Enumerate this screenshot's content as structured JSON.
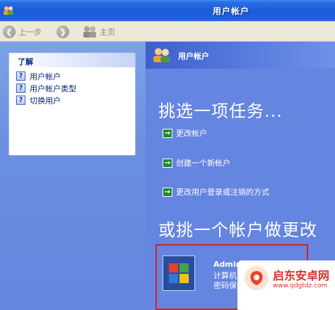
{
  "window": {
    "title": "用户帐户"
  },
  "toolbar": {
    "back_label": "上一步",
    "home_label": "主页"
  },
  "sidebar": {
    "panel_title": "了解",
    "items": [
      {
        "label": "用户帐户",
        "icon": "help-icon"
      },
      {
        "label": "用户帐户类型",
        "icon": "help-icon"
      },
      {
        "label": "切换用户",
        "icon": "help-icon"
      }
    ]
  },
  "main": {
    "header_title": "用户帐户",
    "pick_task": "挑选一项任务...",
    "tasks": [
      {
        "label": "更改帐户",
        "icon": "green-arrow-icon"
      },
      {
        "label": "创建一个新帐户",
        "icon": "green-arrow-icon"
      },
      {
        "label": "更改用户登录或注销的方式",
        "icon": "green-arrow-icon"
      }
    ],
    "pick_account": "或挑一个帐户做更改",
    "account": {
      "name": "Administrator",
      "role": "计算机管理员",
      "status": "密码保护"
    }
  },
  "watermark": {
    "name": "启东安卓网",
    "url": "www.qdgtdz.com"
  },
  "colors": {
    "titlebar": "#1d5ed9",
    "sidebar": "#6b8fe0",
    "main": "#6485e0",
    "highlight_border": "#d0202a",
    "task_arrow": "#1d8a2f"
  }
}
